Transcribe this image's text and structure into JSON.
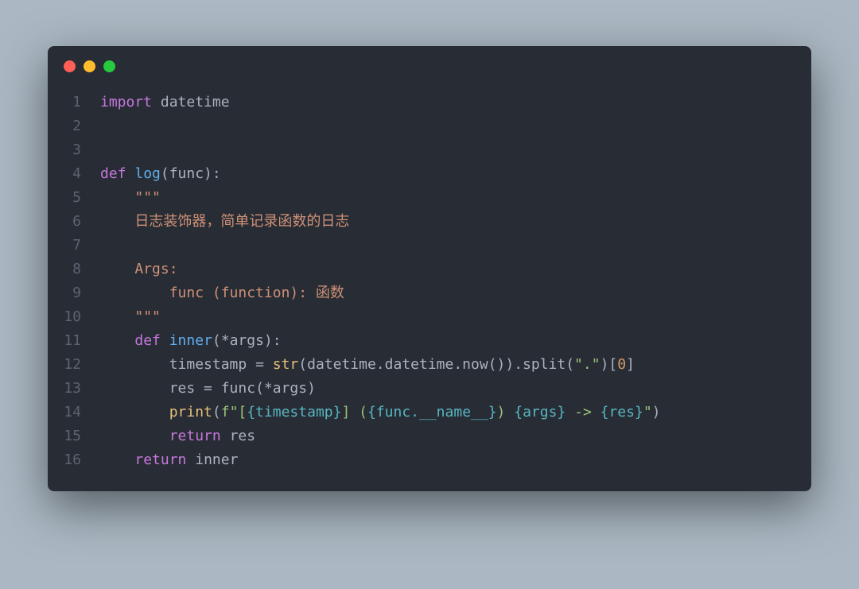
{
  "window": {
    "buttons": [
      "close",
      "minimize",
      "maximize"
    ]
  },
  "code": {
    "lines": [
      {
        "num": "1",
        "tokens": [
          {
            "t": "import",
            "c": "kw"
          },
          {
            "t": " datetime",
            "c": "def"
          }
        ]
      },
      {
        "num": "2",
        "tokens": []
      },
      {
        "num": "3",
        "tokens": []
      },
      {
        "num": "4",
        "tokens": [
          {
            "t": "def",
            "c": "kw"
          },
          {
            "t": " ",
            "c": "def"
          },
          {
            "t": "log",
            "c": "fn"
          },
          {
            "t": "(func):",
            "c": "def"
          }
        ]
      },
      {
        "num": "5",
        "tokens": [
          {
            "t": "    ",
            "c": "def"
          },
          {
            "t": "\"\"\"",
            "c": "doc"
          }
        ]
      },
      {
        "num": "6",
        "tokens": [
          {
            "t": "    日志装饰器，简单记录函数的日志",
            "c": "doc"
          }
        ]
      },
      {
        "num": "7",
        "tokens": []
      },
      {
        "num": "8",
        "tokens": [
          {
            "t": "    Args:",
            "c": "doc"
          }
        ]
      },
      {
        "num": "9",
        "tokens": [
          {
            "t": "        func (function): 函数",
            "c": "doc"
          }
        ]
      },
      {
        "num": "10",
        "tokens": [
          {
            "t": "    ",
            "c": "def"
          },
          {
            "t": "\"\"\"",
            "c": "doc"
          }
        ]
      },
      {
        "num": "11",
        "tokens": [
          {
            "t": "    ",
            "c": "def"
          },
          {
            "t": "def",
            "c": "kw"
          },
          {
            "t": " ",
            "c": "def"
          },
          {
            "t": "inner",
            "c": "fn"
          },
          {
            "t": "(*args):",
            "c": "def"
          }
        ]
      },
      {
        "num": "12",
        "tokens": [
          {
            "t": "        timestamp = ",
            "c": "def"
          },
          {
            "t": "str",
            "c": "builtin"
          },
          {
            "t": "(datetime.datetime.now()).split(",
            "c": "def"
          },
          {
            "t": "\".\"",
            "c": "str"
          },
          {
            "t": ")[",
            "c": "def"
          },
          {
            "t": "0",
            "c": "num"
          },
          {
            "t": "]",
            "c": "def"
          }
        ]
      },
      {
        "num": "13",
        "tokens": [
          {
            "t": "        res = func(*args)",
            "c": "def"
          }
        ]
      },
      {
        "num": "14",
        "tokens": [
          {
            "t": "        ",
            "c": "def"
          },
          {
            "t": "print",
            "c": "builtin"
          },
          {
            "t": "(",
            "c": "def"
          },
          {
            "t": "f\"[",
            "c": "str"
          },
          {
            "t": "{timestamp}",
            "c": "special"
          },
          {
            "t": "] (",
            "c": "str"
          },
          {
            "t": "{func.__name__}",
            "c": "special"
          },
          {
            "t": ") ",
            "c": "str"
          },
          {
            "t": "{args}",
            "c": "special"
          },
          {
            "t": " -> ",
            "c": "str"
          },
          {
            "t": "{res}",
            "c": "special"
          },
          {
            "t": "\"",
            "c": "str"
          },
          {
            "t": ")",
            "c": "def"
          }
        ]
      },
      {
        "num": "15",
        "tokens": [
          {
            "t": "        ",
            "c": "def"
          },
          {
            "t": "return",
            "c": "kw"
          },
          {
            "t": " res",
            "c": "def"
          }
        ]
      },
      {
        "num": "16",
        "tokens": [
          {
            "t": "    ",
            "c": "def"
          },
          {
            "t": "return",
            "c": "kw"
          },
          {
            "t": " inner",
            "c": "def"
          }
        ]
      }
    ]
  }
}
